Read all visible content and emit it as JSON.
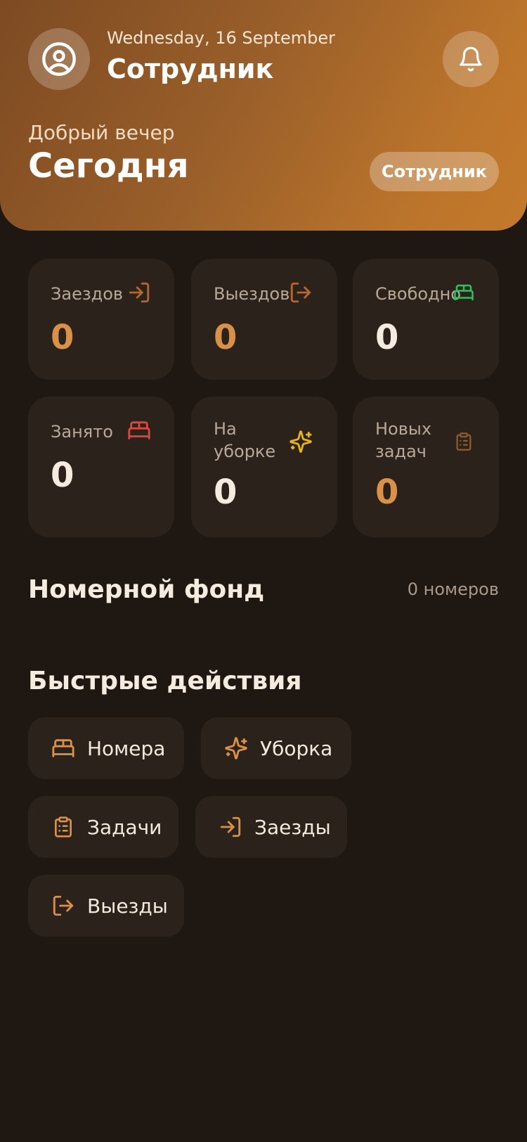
{
  "header": {
    "date": "Wednesday, 16 September",
    "user_title": "Сотрудник",
    "greeting": "Добрый вечер",
    "today": "Сегодня",
    "role_badge": "Сотрудник",
    "avatar_icon": "user-circle-icon",
    "bell_icon": "bell-icon"
  },
  "stats": [
    {
      "label": "Заездов",
      "value": "0",
      "icon": "log-in-icon",
      "icon_color": "#b5672f"
    },
    {
      "label": "Выездов",
      "value": "0",
      "icon": "log-out-icon",
      "icon_color": "#b5672f"
    },
    {
      "label": "Свободно",
      "value": "0",
      "icon": "bed-icon",
      "icon_color": "#2fbf5f"
    },
    {
      "label": "Занято",
      "value": "0",
      "icon": "bed-icon",
      "icon_color": "#e0453f"
    },
    {
      "label": "На уборке",
      "value": "0",
      "icon": "sparkles-icon",
      "icon_color": "#e8b21f"
    },
    {
      "label": "Новых задач",
      "value": "0",
      "icon": "clipboard-icon",
      "icon_color": "#8e5a2c"
    }
  ],
  "room_fund": {
    "title": "Номерной фонд",
    "count": "0 номеров"
  },
  "quick_actions": {
    "title": "Быстрые действия",
    "items": [
      {
        "label": "Номера",
        "icon": "bed-icon"
      },
      {
        "label": "Уборка",
        "icon": "sparkles-icon"
      },
      {
        "label": "Задачи",
        "icon": "clipboard-icon"
      },
      {
        "label": "Заезды",
        "icon": "log-in-icon"
      },
      {
        "label": "Выезды",
        "icon": "log-out-icon"
      }
    ]
  },
  "colors": {
    "background": "#1e1712",
    "card": "#2b221b",
    "accent": "#d9914a"
  }
}
